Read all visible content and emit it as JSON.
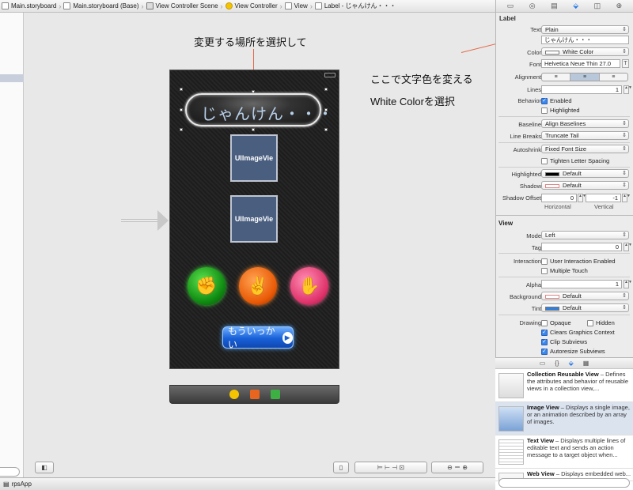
{
  "breadcrumb": [
    {
      "label": "Main.storyboard",
      "icon": "storyboard-icon"
    },
    {
      "label": "Main.storyboard (Base)",
      "icon": "storyboard-icon"
    },
    {
      "label": "View Controller Scene",
      "icon": "scene-icon"
    },
    {
      "label": "View Controller",
      "icon": "view-controller-icon"
    },
    {
      "label": "View",
      "icon": "view-icon"
    },
    {
      "label": "Label - じゃんけん・・・",
      "icon": "label-icon"
    }
  ],
  "annotations": {
    "select_place": "変更する場所を選択して",
    "change_color": "ここで文字色を変える",
    "white_color": "White Colorを選択"
  },
  "scene": {
    "label_text": "じゃんけん・・・",
    "image_view_1": "UIImageVie",
    "image_view_2": "UIImageVie",
    "again_button": "もういっかい",
    "hands": [
      "rock",
      "scissors",
      "paper"
    ]
  },
  "statusbar": {
    "project": "rpsApp"
  },
  "inspector": {
    "label_section": "Label",
    "text_label": "Text",
    "text_value": "Plain",
    "text_field": "じゃんけん・・・",
    "color_label": "Color",
    "color_value": "White Color",
    "font_label": "Font",
    "font_value": "Helvetica Neue Thin 27.0",
    "alignment_label": "Alignment",
    "lines_label": "Lines",
    "lines_value": "1",
    "behavior_label": "Behavior",
    "enabled": "Enabled",
    "highlighted": "Highlighted",
    "baseline_label": "Baseline",
    "baseline_value": "Align Baselines",
    "linebreaks_label": "Line Breaks",
    "linebreaks_value": "Truncate Tail",
    "autoshrink_label": "Autoshrink",
    "autoshrink_value": "Fixed Font Size",
    "tighten": "Tighten Letter Spacing",
    "highlighted_label": "Highlighted",
    "highlighted_value": "Default",
    "shadow_label": "Shadow",
    "shadow_value": "Default",
    "shadow_offset_label": "Shadow Offset",
    "shadow_h": "0",
    "shadow_v": "-1",
    "horizontal": "Horizontal",
    "vertical": "Vertical",
    "view_section": "View",
    "mode_label": "Mode",
    "mode_value": "Left",
    "tag_label": "Tag",
    "tag_value": "0",
    "interaction_label": "Interaction",
    "user_interaction": "User Interaction Enabled",
    "multiple_touch": "Multiple Touch",
    "alpha_label": "Alpha",
    "alpha_value": "1",
    "background_label": "Background",
    "background_value": "Default",
    "tint_label": "Tint",
    "tint_value": "Default",
    "drawing_label": "Drawing",
    "opaque": "Opaque",
    "hidden": "Hidden",
    "clears": "Clears Graphics Context",
    "clip": "Clip Subviews",
    "autoresize": "Autoresize Subviews"
  },
  "library": [
    {
      "title": "Collection Reusable View",
      "desc": " – Defines the attributes and behavior of reusable views in a collection view,..."
    },
    {
      "title": "Image View",
      "desc": " – Displays a single image, or an animation described by an array of images."
    },
    {
      "title": "Text View",
      "desc": " – Displays multiple lines of editable text and sends an action message to a target object when..."
    },
    {
      "title": "Web View",
      "desc": " – Displays embedded web..."
    }
  ],
  "colors": {
    "accent": "#2c7be5",
    "annotation_arrow": "#e56a4a",
    "tint_swatch": "#2e7fe0"
  }
}
